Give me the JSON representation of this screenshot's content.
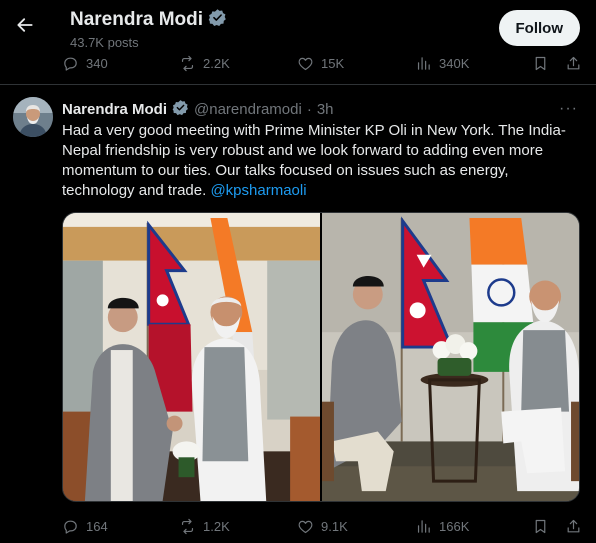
{
  "header": {
    "name": "Narendra Modi",
    "posts": "43.7K posts",
    "follow_label": "Follow"
  },
  "prev_post_actions": {
    "replies": "340",
    "reposts": "2.2K",
    "likes": "15K",
    "views": "340K"
  },
  "tweet": {
    "name": "Narendra Modi",
    "handle": "@narendramodi",
    "dot": "·",
    "time": "3h",
    "more": "···",
    "text": "Had a very good meeting with Prime Minister KP Oli in New York. The India-Nepal friendship is very robust and we look forward to adding even more momentum to our ties. Our talks focused on issues such as energy, technology and trade.",
    "mention": "@kpsharmaoli",
    "actions": {
      "replies": "164",
      "reposts": "1.2K",
      "likes": "9.1K",
      "views": "166K"
    }
  },
  "colors": {
    "background": "#000000",
    "text": "#e7e9ea",
    "muted": "#71767b",
    "link": "#1d9bf0",
    "verified": "#829aab",
    "follow_bg": "#eff3f4"
  },
  "icons": [
    "back-arrow-icon",
    "verified-badge-icon",
    "reply-icon",
    "repost-icon",
    "like-icon",
    "views-icon",
    "bookmark-icon",
    "share-icon",
    "more-icon"
  ]
}
